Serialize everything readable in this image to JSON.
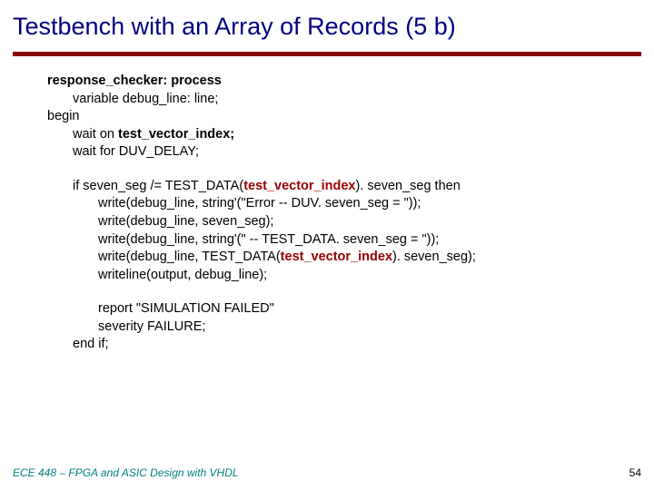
{
  "title": "Testbench with an Array of Records (5 b)",
  "code": {
    "l1a": "response_checker: ",
    "l1b": "process",
    "l2": "variable debug_line: line;",
    "l3": "begin",
    "l4a": "wait on ",
    "l4b": "test_vector_index;",
    "l5": "wait for DUV_DELAY;",
    "l6a": "if seven_seg /= TEST_DATA(",
    "l6b": "test_vector_index",
    "l6c": "). seven_seg then",
    "l7": "write(debug_line, string'(\"Error -- DUV. seven_seg = \"));",
    "l8": "write(debug_line, seven_seg);",
    "l9": "write(debug_line, string'(\" -- TEST_DATA. seven_seg = \"));",
    "l10a": "write(debug_line, TEST_DATA(",
    "l10b": "test_vector_index",
    "l10c": "). seven_seg);",
    "l11": "writeline(output, debug_line);",
    "l12": "report \"SIMULATION FAILED\"",
    "l13": "severity FAILURE;",
    "l14": "end if;"
  },
  "footer": {
    "left": "ECE 448 – FPGA and ASIC Design with VHDL",
    "right": "54"
  }
}
